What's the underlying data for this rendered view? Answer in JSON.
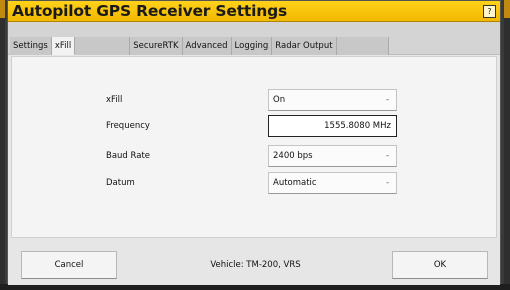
{
  "window": {
    "title": "Autopilot GPS Receiver Settings",
    "help_label": "?"
  },
  "tabs": [
    {
      "label": "Settings",
      "active": false
    },
    {
      "label": "xFill",
      "active": true
    },
    {
      "label": "",
      "active": false
    },
    {
      "label": "SecureRTK",
      "active": false
    },
    {
      "label": "Advanced",
      "active": false
    },
    {
      "label": "Logging",
      "active": false
    },
    {
      "label": "Radar Output",
      "active": false
    },
    {
      "label": "",
      "active": false
    }
  ],
  "form": {
    "xfill": {
      "label": "xFill",
      "value": "On",
      "icon": "dropdown-caret"
    },
    "frequency": {
      "label": "Frequency",
      "value": "1555.8080 MHz"
    },
    "baud_rate": {
      "label": "Baud Rate",
      "value": "2400 bps",
      "icon": "dropdown-caret"
    },
    "datum": {
      "label": "Datum",
      "value": "Automatic",
      "icon": "dropdown-caret"
    },
    "caret_glyph": "-"
  },
  "footer": {
    "cancel_label": "Cancel",
    "ok_label": "OK",
    "vehicle_text": "Vehicle: TM-200, VRS"
  },
  "colors": {
    "title_bar": "#f2b800",
    "dialog_bg": "#e6e6e6",
    "content_bg": "#f4f4f4"
  }
}
